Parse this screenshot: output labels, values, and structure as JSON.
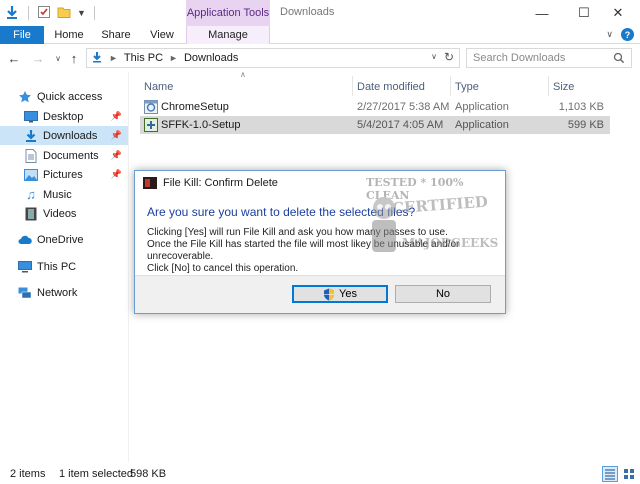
{
  "titlebar": {
    "app_tools": "Application Tools",
    "window_title": "Downloads",
    "minimize": "—",
    "maximize": "☐",
    "close": "✕"
  },
  "ribbon": {
    "tabs": [
      "File",
      "Home",
      "Share",
      "View",
      "Manage"
    ]
  },
  "address": {
    "crumbs": [
      "This PC",
      "Downloads"
    ],
    "search_placeholder": "Search Downloads"
  },
  "nav": {
    "quick_access": "Quick access",
    "items": [
      "Desktop",
      "Downloads",
      "Documents",
      "Pictures",
      "Music",
      "Videos"
    ],
    "onedrive": "OneDrive",
    "thispc": "This PC",
    "network": "Network"
  },
  "list": {
    "columns": [
      "Name",
      "Date modified",
      "Type",
      "Size"
    ],
    "rows": [
      {
        "name": "ChromeSetup",
        "date": "2/27/2017 5:38 AM",
        "type": "Application",
        "size": "1,103 KB"
      },
      {
        "name": "SFFK-1.0-Setup",
        "date": "5/4/2017 4:05 AM",
        "type": "Application",
        "size": "599 KB"
      }
    ]
  },
  "status": {
    "items": "2 items",
    "selected": "1 item selected",
    "size": "598 KB"
  },
  "dialog": {
    "title": "File Kill: Confirm Delete",
    "question": "Are you sure you want to delete the selected files?",
    "line1": "Clicking [Yes] will run File Kill and ask you how many passes to use.",
    "line2": "Once the File Kill has started the file will most likey be unusable and/or unrecoverable.",
    "line3": "Click [No] to cancel this operation.",
    "yes": "Yes",
    "no": "No"
  },
  "watermark": {
    "line1": "TESTED * 100% CLEAN",
    "line2": "CERTIFIED",
    "line3": "MAJORGEEKS"
  },
  "colors": {
    "accent": "#1979ca",
    "app_tools_bg": "#e8d4f0",
    "selection": "#cce4f7",
    "question": "#1a3fa0"
  }
}
